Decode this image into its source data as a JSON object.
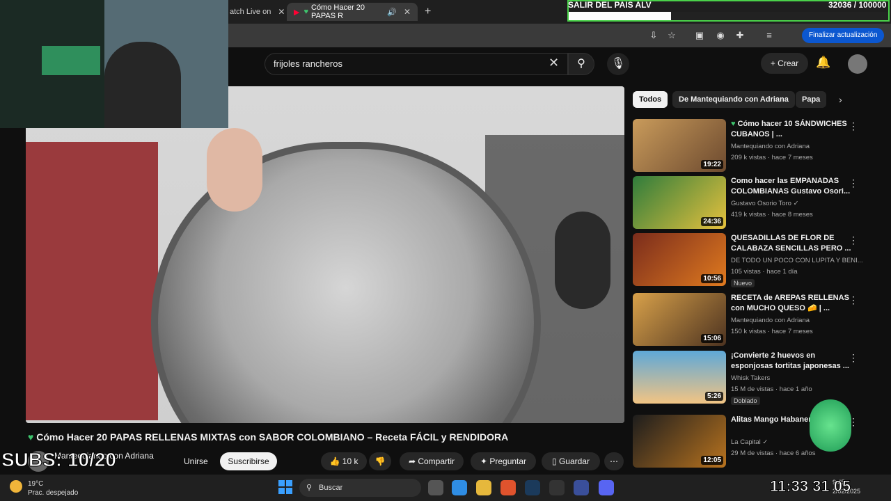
{
  "browser": {
    "tabs": [
      {
        "label": "atch Live on",
        "active": false
      },
      {
        "label": "Cómo Hacer 20 PAPAS R",
        "active": true
      }
    ],
    "new_tab": "+",
    "update_button": "Finalizar actualización"
  },
  "youtube": {
    "search_value": "frijoles rancheros",
    "create_label": "Crear",
    "chips": [
      "Todos",
      "De Mantequiando con Adriana",
      "Papa"
    ],
    "video": {
      "title": "Cómo Hacer 20 PAPAS RELLENAS MIXTAS con SABOR COLOMBIANO – Receta FÁCIL y RENDIDORA",
      "channel": "Mantequiando con Adriana",
      "join_label": "Unirse",
      "subscribe_label": "Suscribirse",
      "likes": "10 k",
      "share_label": "Compartir",
      "ask_label": "Preguntar",
      "save_label": "Guardar"
    },
    "recommendations": [
      {
        "title": "Cómo hacer 10 SÁNDWICHES CUBANOS | ...",
        "channel": "Mantequiando con Adriana",
        "meta": "209 k vistas · hace 7 meses",
        "duration": "19:22",
        "badge": ""
      },
      {
        "title": "Como hacer las EMPANADAS COLOMBIANAS Gustavo Osori...",
        "channel": "Gustavo Osorio Toro ✓",
        "meta": "419 k vistas · hace 8 meses",
        "duration": "24:36",
        "badge": ""
      },
      {
        "title": "QUESADILLAS DE FLOR DE CALABAZA SENCILLAS PERO ...",
        "channel": "DE TODO UN POCO CON LUPITA Y BENI...",
        "meta": "105 vistas · hace 1 día",
        "duration": "10:56",
        "badge": "Nuevo"
      },
      {
        "title": "RECETA de AREPAS RELLENAS con MUCHO QUESO 🧀 | ...",
        "channel": "Mantequiando con Adriana",
        "meta": "150 k vistas · hace 7 meses",
        "duration": "15:06",
        "badge": ""
      },
      {
        "title": "¡Convierte 2 huevos en esponjosas tortitas japonesas ...",
        "channel": "Whisk Takers",
        "meta": "15 M de vistas · hace 1 año",
        "duration": "5:26",
        "badge": "Doblado"
      },
      {
        "title": "Alitas Mango Habanero Capital",
        "channel": "La Capital ✓",
        "meta": "29 M de vistas · hace 6 años",
        "duration": "12:05",
        "badge": ""
      }
    ]
  },
  "stream_overlay": {
    "goal_title": "SALIR DEL PAIS ALV",
    "goal_count": "32036 / 100000",
    "goal_fraction": 0.32,
    "subs_text": "SUBS: 10/20",
    "overlay_clock": "11:33 31 05"
  },
  "taskbar": {
    "temperature": "19°C",
    "weather_desc": "Prac. despejado",
    "search_label": "Buscar",
    "time": "9:45",
    "date": "2/02/2025"
  },
  "colors": {
    "accent_blue": "#0b57d0",
    "goal_green": "#4ad24a",
    "yt_bg": "#0f0f0f"
  }
}
